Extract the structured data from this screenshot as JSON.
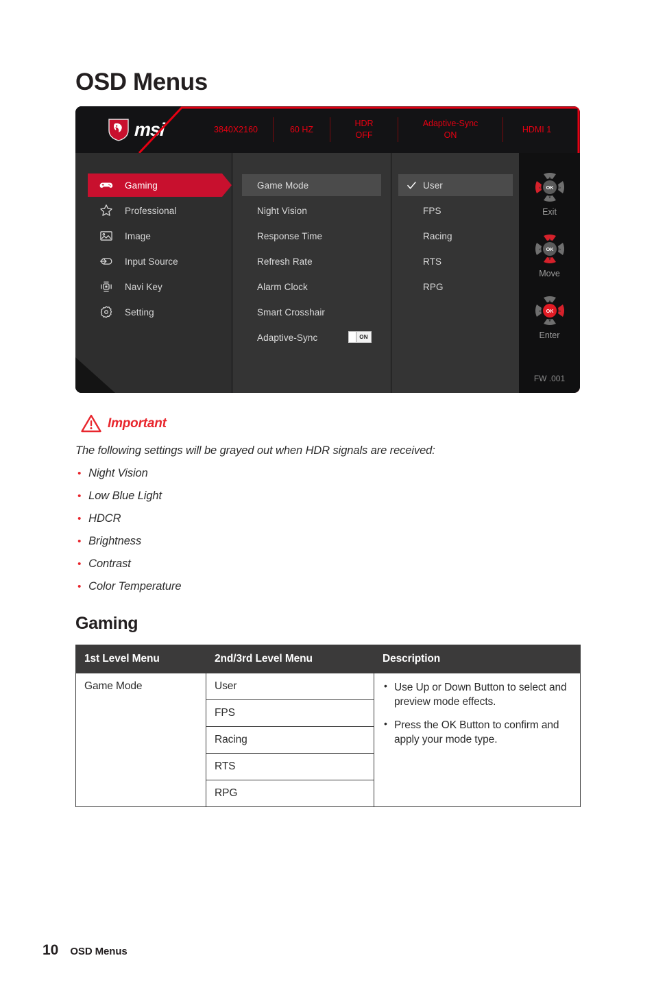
{
  "page": {
    "heading": "OSD Menus",
    "section_heading": "Gaming",
    "footer_page_number": "10",
    "footer_label": "OSD Menus"
  },
  "colors": {
    "brand_red": "#c8102e",
    "status_red": "#e60012",
    "important_red": "#e8262d",
    "osd_black": "#111112",
    "osd_panel": "#343434",
    "osd_sidebar": "#2e2e2e",
    "highlight_row": "#4b4b4b"
  },
  "osd": {
    "logo_text": "msi",
    "status_bar": [
      {
        "line1": "3840X2160",
        "line2": ""
      },
      {
        "line1": "60 HZ",
        "line2": ""
      },
      {
        "line1": "HDR",
        "line2": "OFF"
      },
      {
        "line1": "Adaptive-Sync",
        "line2": "ON"
      },
      {
        "line1": "HDMI 1",
        "line2": ""
      }
    ],
    "sidebar": [
      {
        "label": "Gaming",
        "icon": "gamepad-icon",
        "active": true
      },
      {
        "label": "Professional",
        "icon": "star-icon",
        "active": false
      },
      {
        "label": "Image",
        "icon": "image-icon",
        "active": false
      },
      {
        "label": "Input Source",
        "icon": "input-source-icon",
        "active": false
      },
      {
        "label": "Navi Key",
        "icon": "navi-key-icon",
        "active": false
      },
      {
        "label": "Setting",
        "icon": "gear-icon",
        "active": false
      }
    ],
    "submenu": [
      {
        "label": "Game Mode",
        "highlighted": true
      },
      {
        "label": "Night Vision",
        "highlighted": false
      },
      {
        "label": "Response Time",
        "highlighted": false
      },
      {
        "label": "Refresh Rate",
        "highlighted": false
      },
      {
        "label": "Alarm Clock",
        "highlighted": false
      },
      {
        "label": "Smart Crosshair",
        "highlighted": false
      },
      {
        "label": "Adaptive-Sync",
        "highlighted": false,
        "toggle": "ON"
      }
    ],
    "options": [
      {
        "label": "User",
        "selected": true
      },
      {
        "label": "FPS",
        "selected": false
      },
      {
        "label": "Racing",
        "selected": false
      },
      {
        "label": "RTS",
        "selected": false
      },
      {
        "label": "RPG",
        "selected": false
      }
    ],
    "nav_hints": [
      {
        "label": "Exit",
        "highlight": "left"
      },
      {
        "label": "Move",
        "highlight": "up-down"
      },
      {
        "label": "Enter",
        "highlight": "center-right"
      }
    ],
    "firmware": "FW .001"
  },
  "important": {
    "title": "Important",
    "lead": "The following settings will be grayed out when HDR signals are received:",
    "items": [
      "Night Vision",
      "Low Blue Light",
      "HDCR",
      "Brightness",
      "Contrast",
      "Color Temperature"
    ]
  },
  "table": {
    "headers": [
      "1st Level Menu",
      "2nd/3rd Level Menu",
      "Description"
    ],
    "first_level": "Game Mode",
    "second_level": [
      "User",
      "FPS",
      "Racing",
      "RTS",
      "RPG"
    ],
    "description": [
      "Use Up or Down Button to select and preview mode effects.",
      "Press the OK Button to confirm and apply your mode type."
    ]
  }
}
